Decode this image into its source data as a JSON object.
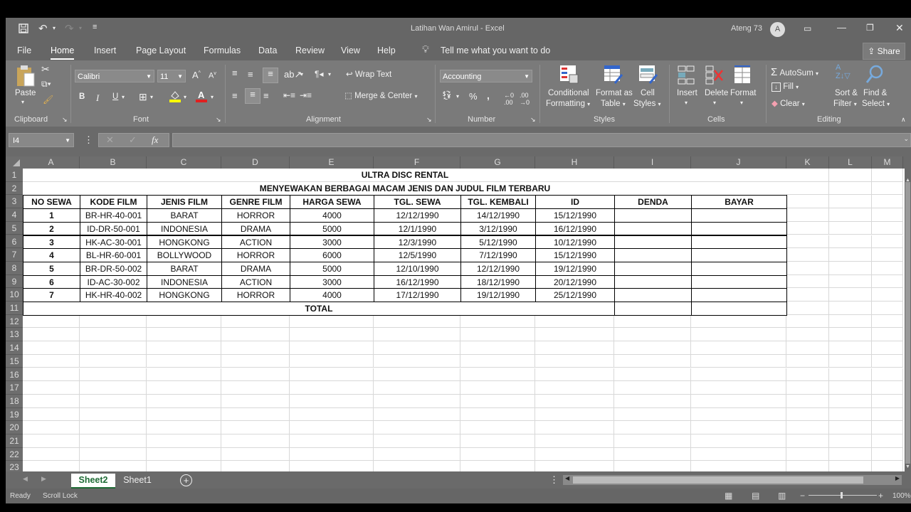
{
  "window": {
    "title": "Latihan Wan Amirul  -  Excel",
    "user": "Ateng 73",
    "avatar": "A"
  },
  "quick_access": {
    "save_icon": "save-icon",
    "undo_icon": "undo-icon",
    "redo_icon": "redo-icon"
  },
  "tabs": [
    "File",
    "Home",
    "Insert",
    "Page Layout",
    "Formulas",
    "Data",
    "Review",
    "View",
    "Help"
  ],
  "active_tab": "Home",
  "tell_me": "Tell me what you want to do",
  "share_label": "Share",
  "ribbon": {
    "clipboard": {
      "label": "Clipboard",
      "paste": "Paste"
    },
    "font": {
      "label": "Font",
      "font_name": "Calibri",
      "font_size": "11",
      "bold": "B",
      "italic": "I",
      "underline": "U"
    },
    "alignment": {
      "label": "Alignment",
      "wrap_text": "Wrap Text",
      "merge_center": "Merge & Center"
    },
    "number": {
      "label": "Number",
      "format": "Accounting",
      "percent": "%",
      "comma": ","
    },
    "styles": {
      "label": "Styles",
      "conditional": "Conditional",
      "conditional2": "Formatting",
      "format_as": "Format as",
      "format_as2": "Table",
      "cell": "Cell",
      "cell2": "Styles"
    },
    "cells": {
      "label": "Cells",
      "insert": "Insert",
      "delete": "Delete",
      "format": "Format"
    },
    "editing": {
      "label": "Editing",
      "autosum": "AutoSum",
      "fill": "Fill",
      "clear": "Clear",
      "sort": "Sort &",
      "sort2": "Filter",
      "find": "Find &",
      "find2": "Select"
    }
  },
  "formula_bar": {
    "name_box": "I4",
    "fx": "fx",
    "value": ""
  },
  "columns": [
    "A",
    "B",
    "C",
    "D",
    "E",
    "F",
    "G",
    "H",
    "I",
    "J",
    "K",
    "L",
    "M"
  ],
  "rows": [
    "1",
    "2",
    "3",
    "4",
    "5",
    "6",
    "7",
    "8",
    "9",
    "10",
    "11",
    "12",
    "13",
    "14",
    "15",
    "16",
    "17",
    "18",
    "19",
    "20",
    "21",
    "22",
    "23"
  ],
  "sheet": {
    "title": "ULTRA DISC RENTAL",
    "subtitle": "MENYEWAKAN BERBAGAI MACAM JENIS DAN JUDUL FILM TERBARU",
    "headers": [
      "NO SEWA",
      "KODE FILM",
      "JENIS FILM",
      "GENRE FILM",
      "HARGA SEWA",
      "TGL. SEWA",
      "TGL. KEMBALI",
      "ID",
      "DENDA",
      "BAYAR"
    ],
    "data": [
      [
        "1",
        "BR-HR-40-001",
        "BARAT",
        "HORROR",
        "4000",
        "12/12/1990",
        "14/12/1990",
        "15/12/1990",
        "",
        ""
      ],
      [
        "2",
        "ID-DR-50-001",
        "INDONESIA",
        "DRAMA",
        "5000",
        "12/1/1990",
        "3/12/1990",
        "16/12/1990",
        "",
        ""
      ],
      [
        "3",
        "HK-AC-30-001",
        "HONGKONG",
        "ACTION",
        "3000",
        "12/3/1990",
        "5/12/1990",
        "10/12/1990",
        "",
        ""
      ],
      [
        "4",
        "BL-HR-60-001",
        "BOLLYWOOD",
        "HORROR",
        "6000",
        "12/5/1990",
        "7/12/1990",
        "15/12/1990",
        "",
        ""
      ],
      [
        "5",
        "BR-DR-50-002",
        "BARAT",
        "DRAMA",
        "5000",
        "12/10/1990",
        "12/12/1990",
        "19/12/1990",
        "",
        ""
      ],
      [
        "6",
        "ID-AC-30-002",
        "INDONESIA",
        "ACTION",
        "3000",
        "16/12/1990",
        "18/12/1990",
        "20/12/1990",
        "",
        ""
      ],
      [
        "7",
        "HK-HR-40-002",
        "HONGKONG",
        "HORROR",
        "4000",
        "17/12/1990",
        "19/12/1990",
        "25/12/1990",
        "",
        ""
      ]
    ],
    "total_label": "TOTAL"
  },
  "sheet_tabs": [
    "Sheet2",
    "Sheet1"
  ],
  "active_sheet": "Sheet2",
  "status": {
    "ready": "Ready",
    "scroll_lock": "Scroll Lock",
    "zoom": "100%"
  }
}
